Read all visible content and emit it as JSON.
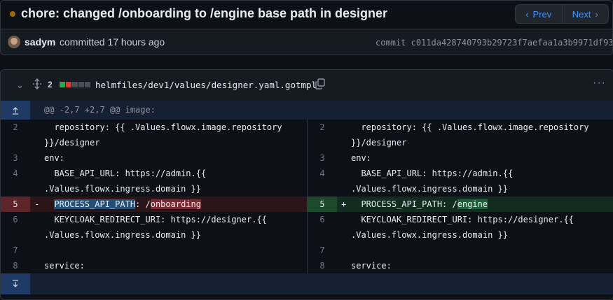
{
  "commit": {
    "title": "chore: changed /onboarding to /engine base path in designer",
    "prev_label": "Prev",
    "next_label": "Next",
    "author": "sadym",
    "meta": "committed 17 hours ago",
    "hash_label": "commit",
    "hash": "c011da428740793b29723f7aefaa1a3b9971df93",
    "status_color": "#9e6a03"
  },
  "file": {
    "changes_count": "2",
    "path": "helmfiles/dev1/values/designer.yaml.gotmpl",
    "diffstat": [
      "#2da44e",
      "#da3633",
      "#484f58",
      "#484f58",
      "#484f58"
    ]
  },
  "hunk": {
    "header": "@@ -2,7 +2,7 @@ image:"
  },
  "diff": {
    "rows": [
      {
        "left_ln": "2",
        "left_code": "  repository: {{ .Values.flowx.image.repository\n}}/designer",
        "right_ln": "2",
        "right_code": "  repository: {{ .Values.flowx.image.repository\n}}/designer"
      },
      {
        "left_ln": "3",
        "left_code": "env:",
        "right_ln": "3",
        "right_code": "env:"
      },
      {
        "left_ln": "4",
        "left_code": "  BASE_API_URL: https://admin.{{\n.Values.flowx.ingress.domain }}",
        "right_ln": "4",
        "right_code": "  BASE_API_URL: https://admin.{{\n.Values.flowx.ingress.domain }}"
      },
      {
        "left_ln": "5",
        "left_marker": "-",
        "left_prefix": "  ",
        "left_key": "PROCESS_API_PATH",
        "left_sep": ": /",
        "left_val": "onboarding",
        "right_ln": "5",
        "right_marker": "+",
        "right_prefix": "  PROCESS_API_PATH: /",
        "right_val": "engine"
      },
      {
        "left_ln": "6",
        "left_code": "  KEYCLOAK_REDIRECT_URI: https://designer.{{\n.Values.flowx.ingress.domain }}",
        "right_ln": "6",
        "right_code": "  KEYCLOAK_REDIRECT_URI: https://designer.{{\n.Values.flowx.ingress.domain }}"
      },
      {
        "left_ln": "7",
        "left_code": "",
        "right_ln": "7",
        "right_code": ""
      },
      {
        "left_ln": "8",
        "left_code": "service:",
        "right_ln": "8",
        "right_code": "service:"
      }
    ]
  },
  "icons": {
    "prev": "chevron-left-icon",
    "next": "chevron-right-icon",
    "collapse": "chevron-down-icon",
    "expand": "unfold-icon",
    "copy": "copy-icon",
    "more": "kebab-horizontal-icon",
    "expand_up": "fold-up-icon",
    "expand_down": "fold-down-icon"
  }
}
